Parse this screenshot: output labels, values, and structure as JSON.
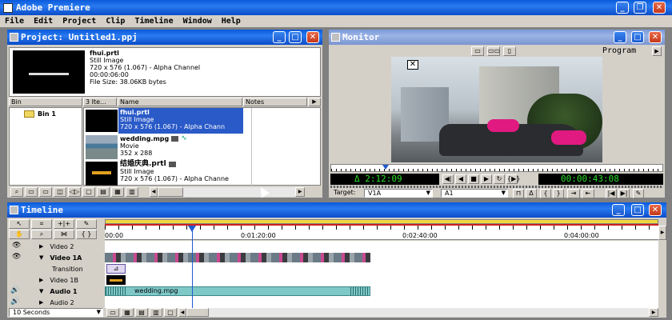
{
  "app": {
    "title": "Adobe Premiere"
  },
  "menu": [
    "File",
    "Edit",
    "Project",
    "Clip",
    "Timeline",
    "Window",
    "Help"
  ],
  "project": {
    "title": "Project: Untitled1.ppj",
    "preview": {
      "name": "fhui.prtl",
      "type": "Still Image",
      "dims": "720 x 576 (1.067) - Alpha Channel",
      "duration": "00:00:06:00",
      "size": "File Size: 38.06KB bytes"
    },
    "columns": {
      "bin": "Bin",
      "count": "3 Ite...",
      "name": "Name",
      "notes": "Notes"
    },
    "bins": [
      "Bin 1"
    ],
    "items": [
      {
        "name": "fhui.prtl",
        "type": "Still Image",
        "dims": "720 x 576 (1.067) - Alpha Chann"
      },
      {
        "name": "wedding.mpg",
        "type": "Movie",
        "dims": "352 x 288"
      },
      {
        "name": "结婚庆典.prtl",
        "type": "Still Image",
        "dims": "720 x 576 (1.067) - Alpha Channe"
      }
    ]
  },
  "monitor": {
    "title": "Monitor",
    "mode": "Program",
    "timecode_left": "Δ 2:12:09",
    "timecode_right": "00:00:43:08",
    "target_label": "Target:",
    "target_video": "V1A",
    "target_audio": "A1"
  },
  "timeline": {
    "title": "Timeline",
    "ruler": [
      "00:00",
      "0:01:20:00",
      "0:02:40:00",
      "0:04:00:00"
    ],
    "tracks": [
      "Video 2",
      "Video 1A",
      "Transition",
      "Video 1B",
      "Audio 1",
      "Audio 2"
    ],
    "audio_clip": "wedding.mpg",
    "zoom": "10 Seconds"
  }
}
